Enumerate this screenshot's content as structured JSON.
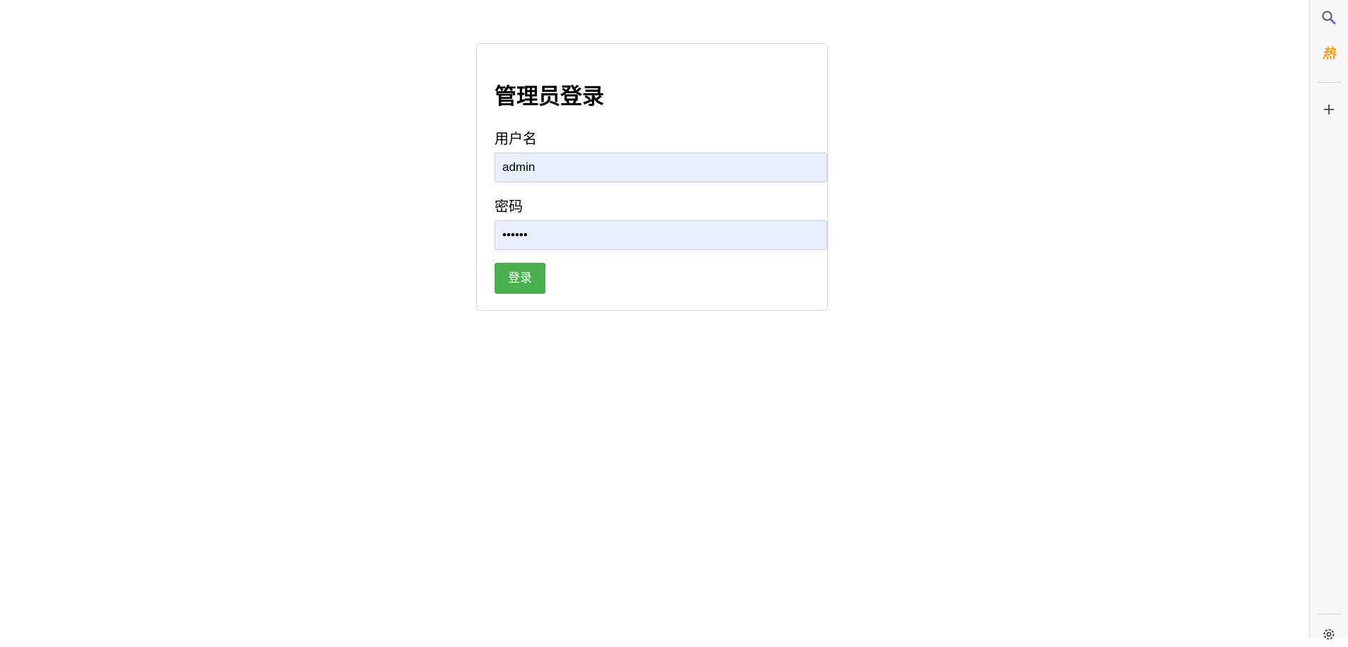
{
  "login": {
    "title": "管理员登录",
    "username_label": "用户名",
    "username_value": "admin",
    "password_label": "密码",
    "password_value": "123456",
    "submit_label": "登录"
  },
  "sidebar": {
    "hot_label": "热",
    "icons": [
      "search-icon",
      "hot-icon",
      "plus-icon",
      "gear-icon"
    ]
  },
  "colors": {
    "button_bg": "#4caf50",
    "input_autofill_bg": "#e8f0fe",
    "hot_accent": "#ff9a1f",
    "search_accent": "#7a5cc7"
  }
}
